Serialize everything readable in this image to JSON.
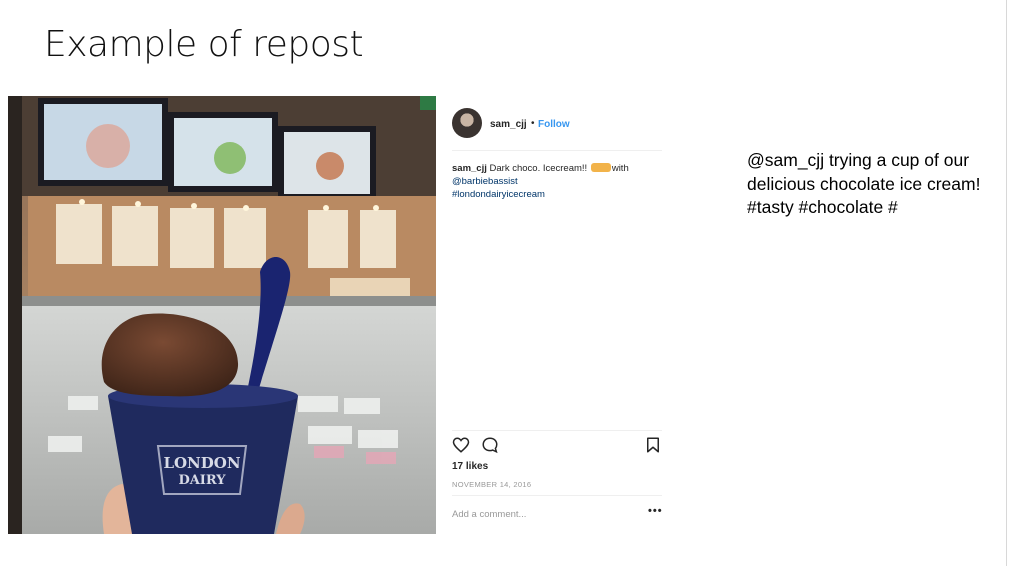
{
  "slide": {
    "title": "Example of repost",
    "side_text": "@sam_cjj trying a cup of our delicious chocolate ice cream! #tasty #chocolate #"
  },
  "photo": {
    "cup_brand_line1": "LONDON",
    "cup_brand_line2": "DAIRY"
  },
  "post": {
    "username": "sam_cjj",
    "dot": "•",
    "follow_label": "Follow",
    "caption": {
      "username": "sam_cjj",
      "text_before": "Dark choco. Icecream!!",
      "text_after": "with",
      "mention": "@barbiebassist",
      "hashtag": "#londondairyicecream"
    },
    "likes": "17 likes",
    "date": "NOVEMBER 14, 2016",
    "comment_placeholder": "Add a comment...",
    "more_label": "•••"
  },
  "colors": {
    "follow": "#3897f0",
    "link": "#003569",
    "cup": "#1f2a5e"
  },
  "icons": [
    "heart-icon",
    "comment-icon",
    "bookmark-icon",
    "more-icon",
    "emoji-icon"
  ]
}
